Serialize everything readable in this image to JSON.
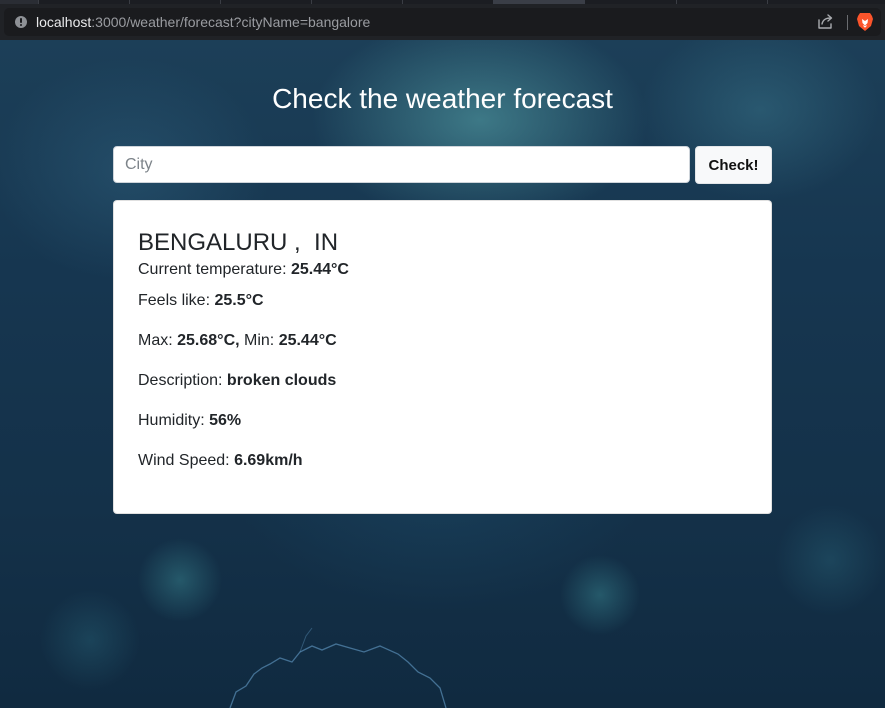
{
  "browser": {
    "url_host": "localhost",
    "url_path": ":3000/weather/forecast?cityName=bangalore"
  },
  "page": {
    "title": "Check the weather forecast"
  },
  "search": {
    "value": "",
    "placeholder": "City",
    "button_label": "Check!"
  },
  "result": {
    "city": "BENGALURU",
    "separator": " ,  ",
    "country": "IN",
    "current_temperature": {
      "label": "Current temperature: ",
      "value": "25.44°C"
    },
    "feels_like": {
      "label": "Feels like: ",
      "value": "25.5°C"
    },
    "max": {
      "label": "Max: ",
      "value": "25.68°C,"
    },
    "min": {
      "label": " Min: ",
      "value": "25.44°C"
    },
    "description": {
      "label": "Description: ",
      "value": "broken clouds"
    },
    "humidity": {
      "label": "Humidity: ",
      "value": "56%"
    },
    "wind_speed": {
      "label": "Wind Speed: ",
      "value": "6.69km/h"
    }
  },
  "colors": {
    "background": "#163650",
    "accent_brave": "#fb542b",
    "text": "#212529"
  },
  "icons": [
    "info-icon",
    "share-icon",
    "brave-lion-icon"
  ]
}
